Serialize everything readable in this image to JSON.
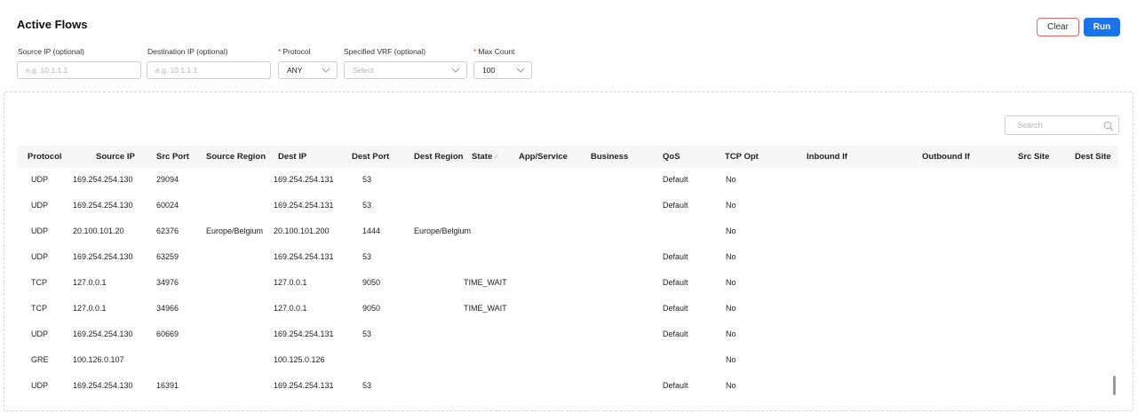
{
  "page": {
    "title": "Active Flows"
  },
  "actions": {
    "clear_label": "Clear",
    "run_label": "Run"
  },
  "filters": {
    "source_ip": {
      "label": "Source IP (optional)",
      "placeholder": "e.g. 10.1.1.1"
    },
    "dest_ip": {
      "label": "Destination IP (optional)",
      "placeholder": "e.g. 10.1.1.1"
    },
    "protocol": {
      "required_mark": "*",
      "label": "Protocol",
      "value": "ANY"
    },
    "vrf": {
      "label": "Specified VRF (optional)",
      "placeholder": "Select"
    },
    "max_count": {
      "required_mark": "*",
      "label": "Max Count",
      "value": "100"
    }
  },
  "table": {
    "search_placeholder": "Search",
    "sort_indicator": "✓",
    "columns": [
      "Protocol",
      "Source IP",
      "Src Port",
      "Source Region",
      "Dest IP",
      "Dest Port",
      "Dest Region",
      "State",
      "App/Service",
      "Business",
      "QoS",
      "TCP Opt",
      "Inbound If",
      "Outbound If",
      "Src Site",
      "Dest Site"
    ],
    "rows": [
      {
        "protocol": "UDP",
        "source_ip": "169.254.254.130",
        "src_port": "29094",
        "source_region": "",
        "dest_ip": "169.254.254.131",
        "dest_port": "53",
        "dest_region": "",
        "state": "",
        "qos": "Default",
        "tcp_opt": "No"
      },
      {
        "protocol": "UDP",
        "source_ip": "169.254.254.130",
        "src_port": "60024",
        "source_region": "",
        "dest_ip": "169.254.254.131",
        "dest_port": "53",
        "dest_region": "",
        "state": "",
        "qos": "Default",
        "tcp_opt": "No"
      },
      {
        "protocol": "UDP",
        "source_ip": "20.100.101.20",
        "src_port": "62376",
        "source_region": "Europe/Belgium",
        "dest_ip": "20.100.101.200",
        "dest_port": "1444",
        "dest_region": "Europe/Belgium",
        "state": "",
        "qos": "",
        "tcp_opt": "No"
      },
      {
        "protocol": "UDP",
        "source_ip": "169.254.254.130",
        "src_port": "63259",
        "source_region": "",
        "dest_ip": "169.254.254.131",
        "dest_port": "53",
        "dest_region": "",
        "state": "",
        "qos": "Default",
        "tcp_opt": "No"
      },
      {
        "protocol": "TCP",
        "source_ip": "127.0.0.1",
        "src_port": "34976",
        "source_region": "",
        "dest_ip": "127.0.0.1",
        "dest_port": "9050",
        "dest_region": "",
        "state": "TIME_WAIT",
        "qos": "Default",
        "tcp_opt": "No"
      },
      {
        "protocol": "TCP",
        "source_ip": "127.0.0.1",
        "src_port": "34966",
        "source_region": "",
        "dest_ip": "127.0.0.1",
        "dest_port": "9050",
        "dest_region": "",
        "state": "TIME_WAIT",
        "qos": "Default",
        "tcp_opt": "No"
      },
      {
        "protocol": "UDP",
        "source_ip": "169.254.254.130",
        "src_port": "60669",
        "source_region": "",
        "dest_ip": "169.254.254.131",
        "dest_port": "53",
        "dest_region": "",
        "state": "",
        "qos": "Default",
        "tcp_opt": "No"
      },
      {
        "protocol": "GRE",
        "source_ip": "100.126.0.107",
        "src_port": "",
        "source_region": "",
        "dest_ip": "100.125.0.126",
        "dest_port": "",
        "dest_region": "",
        "state": "",
        "qos": "",
        "tcp_opt": "No"
      },
      {
        "protocol": "UDP",
        "source_ip": "169.254.254.130",
        "src_port": "16391",
        "source_region": "",
        "dest_ip": "169.254.254.131",
        "dest_port": "53",
        "dest_region": "",
        "state": "",
        "qos": "Default",
        "tcp_opt": "No"
      }
    ]
  },
  "icons": {
    "search": "search-icon",
    "chevron": "chevron-down-icon"
  },
  "colors": {
    "primary": "#1a73e8",
    "danger_border": "#e06a6a",
    "required": "#e0342b",
    "header_bg": "#f7f7f7"
  }
}
